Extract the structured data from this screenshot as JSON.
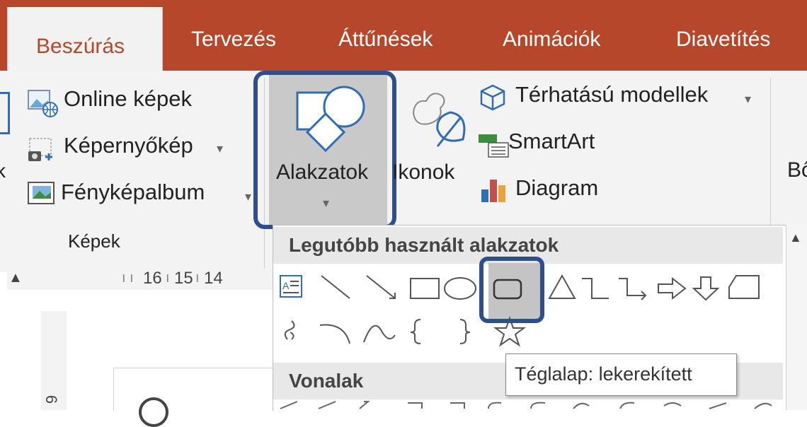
{
  "tabs": {
    "active": "Beszúrás",
    "others": [
      "Tervezés",
      "Áttűnések",
      "Animációk",
      "Diavetítés"
    ]
  },
  "ribbon": {
    "images_group": {
      "online_images": "Online képek",
      "screenshot": "Képernyőkép",
      "photo_album": "Fényképalbum",
      "group_label": "Képek"
    },
    "shapes_label": "Alakzatok",
    "icons_label": "Ikonok",
    "models_3d": "Térhatású modellek",
    "smartart": "SmartArt",
    "chart": "Diagram",
    "cut_off_group": "Bő",
    "left_cut": "k"
  },
  "ruler": {
    "numbers": [
      "16",
      "15",
      "14"
    ],
    "side_number": "6"
  },
  "gallery": {
    "recent_header": "Legutóbb használt alakzatok",
    "lines_header": "Vonalak",
    "tooltip": "Téglalap: lekerekített"
  },
  "colors": {
    "tab_bar": "#b7472a",
    "highlight_outline": "#2f4e8d"
  }
}
